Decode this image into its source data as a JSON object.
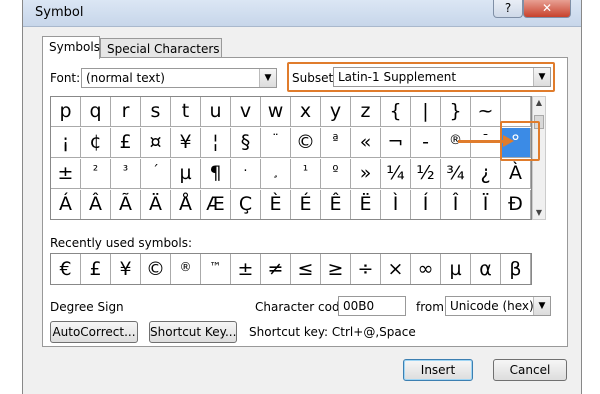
{
  "window": {
    "title": "Symbol",
    "help_label": "?",
    "close_label": "✕"
  },
  "tabs": [
    {
      "label": "Symbols"
    },
    {
      "label": "Special Characters"
    }
  ],
  "font": {
    "label": "Font:",
    "value": "(normal text)"
  },
  "subset": {
    "label": "Subset:",
    "value": "Latin-1 Supplement"
  },
  "grid": {
    "rows": [
      [
        "p",
        "q",
        "r",
        "s",
        "t",
        "u",
        "v",
        "w",
        "x",
        "y",
        "z",
        "{",
        "|",
        "}",
        "~",
        ""
      ],
      [
        "¡",
        "¢",
        "£",
        "¤",
        "¥",
        "¦",
        "§",
        "¨",
        "©",
        "ª",
        "«",
        "¬",
        "-",
        "®",
        "¯",
        "°"
      ],
      [
        "±",
        "²",
        "³",
        "´",
        "µ",
        "¶",
        "·",
        "¸",
        "¹",
        "º",
        "»",
        "¼",
        "½",
        "¾",
        "¿",
        "À"
      ],
      [
        "Á",
        "Â",
        "Ã",
        "Ä",
        "Å",
        "Æ",
        "Ç",
        "È",
        "É",
        "Ê",
        "Ë",
        "Ì",
        "Í",
        "Î",
        "Ï",
        "Ð"
      ]
    ],
    "selected_symbol": "°"
  },
  "recent": {
    "label": "Recently used symbols:",
    "symbols": [
      "€",
      "£",
      "¥",
      "©",
      "®",
      "™",
      "±",
      "≠",
      "≤",
      "≥",
      "÷",
      "×",
      "∞",
      "µ",
      "α",
      "β"
    ]
  },
  "info": {
    "char_name": "Degree Sign",
    "char_code_label": "Character code:",
    "char_code": "00B0",
    "from_label": "from:",
    "from_value": "Unicode (hex)"
  },
  "buttons": {
    "autocorrect": "AutoCorrect...",
    "shortcut_key": "Shortcut Key...",
    "shortcut_text": "Shortcut key: Ctrl+@,Space",
    "insert": "Insert",
    "cancel": "Cancel"
  },
  "colors": {
    "accent": "#e07c2c",
    "selection": "#3b8be6"
  }
}
